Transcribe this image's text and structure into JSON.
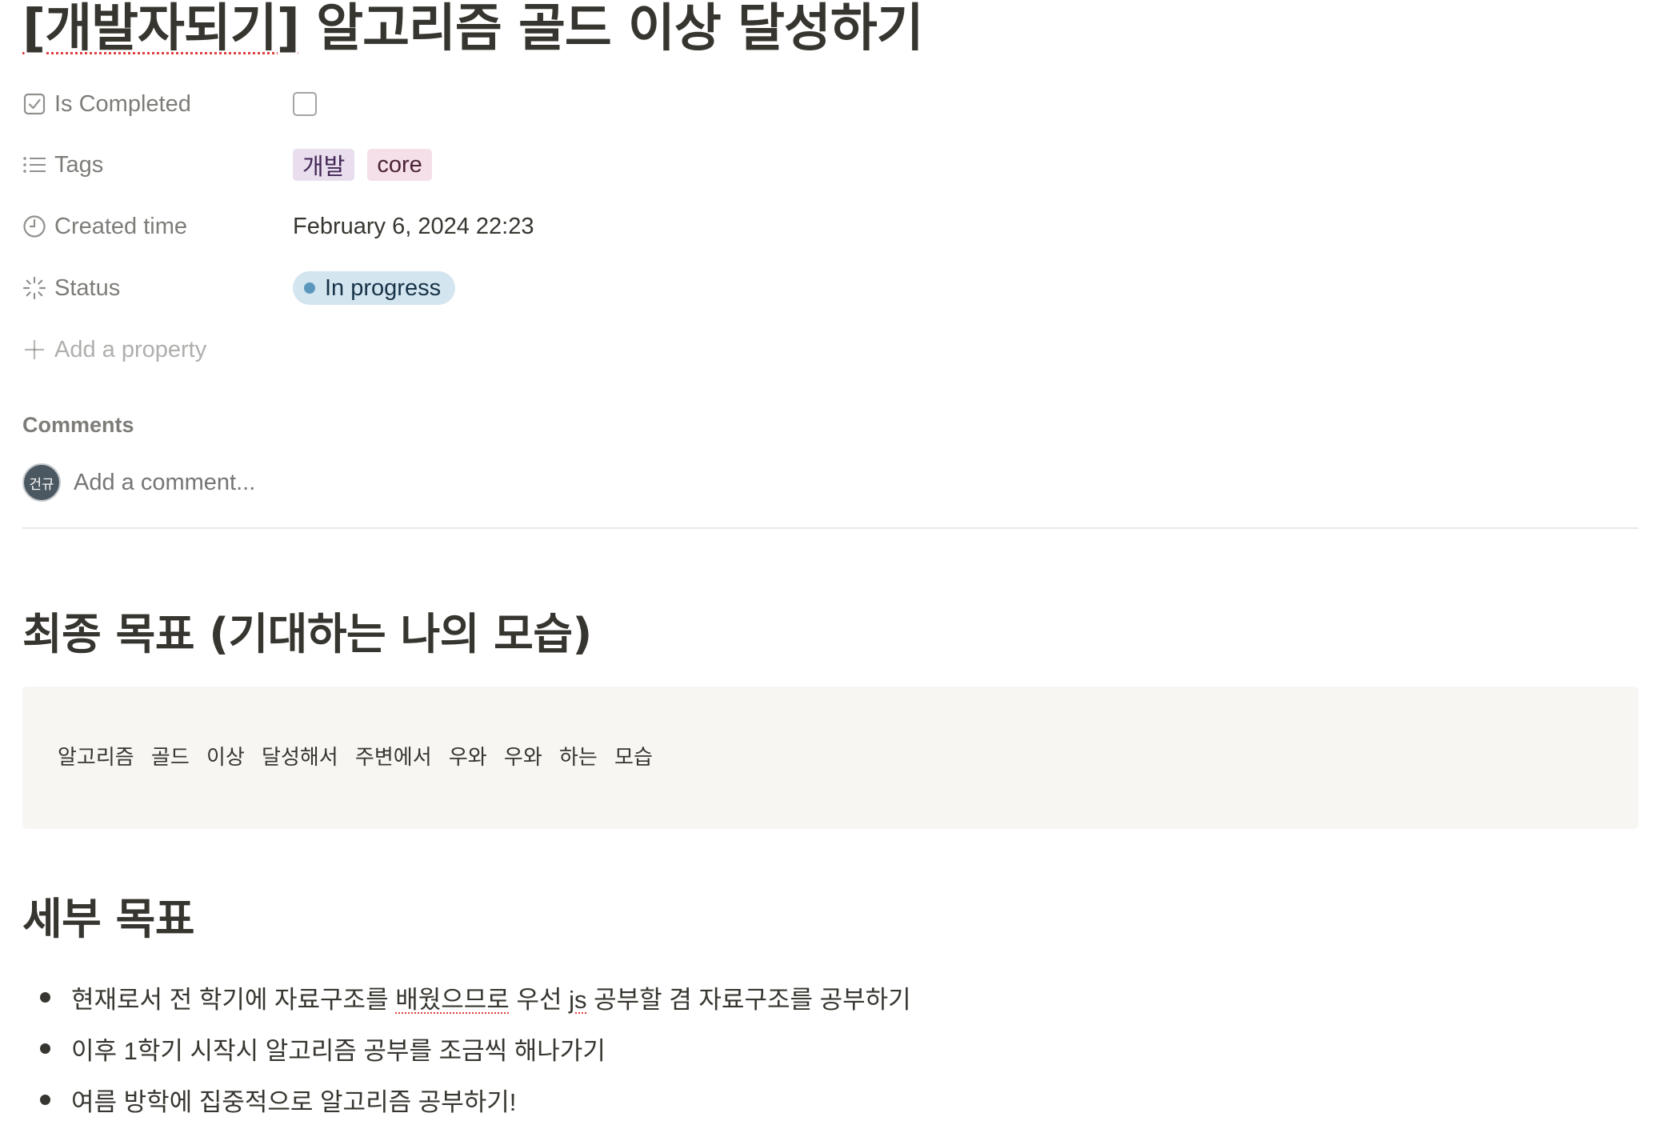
{
  "page": {
    "title_part1": "[개발자되기]",
    "title_part2": " 알고리즘 골드 이상 달성하기"
  },
  "properties": [
    {
      "label": "Is Completed",
      "icon": "checkbox-icon",
      "value_type": "checkbox",
      "checked": false
    },
    {
      "label": "Tags",
      "icon": "list-icon",
      "value_type": "tags",
      "tags": [
        {
          "label": "개발",
          "color": "#e8deee"
        },
        {
          "label": "core",
          "color": "#f5e0e9"
        }
      ]
    },
    {
      "label": "Created time",
      "icon": "clock-icon",
      "value": "February 6, 2024 22:23"
    },
    {
      "label": "Status",
      "icon": "status-spinner-icon",
      "value": "In progress",
      "status_color": "#5b97bd"
    }
  ],
  "add_property_label": "Add a property",
  "comments": {
    "heading": "Comments",
    "avatar_initials": "건규",
    "placeholder": "Add a comment..."
  },
  "content": {
    "heading1": "최종 목표 (기대하는 나의 모습)",
    "quote": "알고리즘 골드 이상 달성해서 주변에서 우와 우와 하는 모습",
    "heading2": "세부 목표",
    "bullets": [
      {
        "before": "현재로서 전 학기에 자료구조를 ",
        "squiggle1": "배웠으므로",
        "middle": " 우선 ",
        "squiggle2": "js",
        "after": " 공부할 겸 자료구조를 공부하기"
      },
      {
        "text": "이후 1학기 시작시 알고리즘 공부를 조금씩 해나가기"
      },
      {
        "text": "여름 방학에 집중적으로 알고리즘 공부하기!"
      }
    ]
  }
}
